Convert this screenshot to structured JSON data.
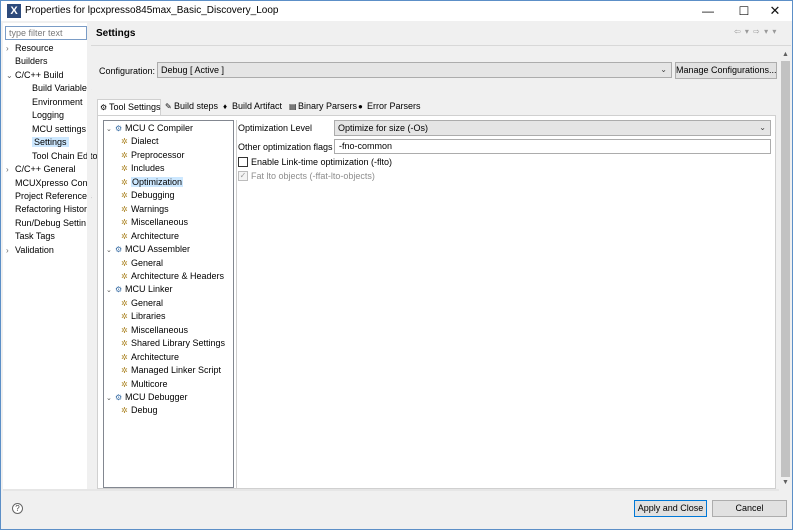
{
  "window": {
    "title": "Properties for lpcxpresso845max_Basic_Discovery_Loop",
    "app_icon": "X"
  },
  "filter": {
    "placeholder": "type filter text"
  },
  "nav": {
    "items": [
      {
        "label": "Resource",
        "toggle": "›"
      },
      {
        "label": "Builders",
        "toggle": ""
      },
      {
        "label": "C/C++ Build",
        "toggle": "⌄"
      },
      {
        "label": "Build Variables",
        "toggle": ""
      },
      {
        "label": "Environment",
        "toggle": ""
      },
      {
        "label": "Logging",
        "toggle": ""
      },
      {
        "label": "MCU settings",
        "toggle": ""
      },
      {
        "label": "Settings",
        "toggle": ""
      },
      {
        "label": "Tool Chain Edito",
        "toggle": ""
      },
      {
        "label": "C/C++ General",
        "toggle": "›"
      },
      {
        "label": "MCUXpresso Con",
        "toggle": ""
      },
      {
        "label": "Project References",
        "toggle": ""
      },
      {
        "label": "Refactoring Histor",
        "toggle": ""
      },
      {
        "label": "Run/Debug Settin",
        "toggle": ""
      },
      {
        "label": "Task Tags",
        "toggle": ""
      },
      {
        "label": "Validation",
        "toggle": "›"
      }
    ],
    "selected": "Settings"
  },
  "page": {
    "title": "Settings"
  },
  "configuration": {
    "label": "Configuration:",
    "value": "Debug  [ Active ]",
    "manage_button": "Manage Configurations..."
  },
  "tabs": [
    {
      "label": "Tool Settings",
      "icon": "⚙",
      "active": true
    },
    {
      "label": "Build steps",
      "icon": "✎",
      "active": false
    },
    {
      "label": "Build Artifact",
      "icon": "♦",
      "active": false
    },
    {
      "label": "Binary Parsers",
      "icon": "▤",
      "active": false
    },
    {
      "label": "Error Parsers",
      "icon": "●",
      "active": false
    }
  ],
  "tree": {
    "rows": [
      {
        "label": "MCU C Compiler",
        "level": 0,
        "toggle": "⌄",
        "icon": "tool"
      },
      {
        "label": "Dialect",
        "level": 1,
        "icon": "gear"
      },
      {
        "label": "Preprocessor",
        "level": 1,
        "icon": "gear"
      },
      {
        "label": "Includes",
        "level": 1,
        "icon": "gear"
      },
      {
        "label": "Optimization",
        "level": 1,
        "icon": "gear"
      },
      {
        "label": "Debugging",
        "level": 1,
        "icon": "gear"
      },
      {
        "label": "Warnings",
        "level": 1,
        "icon": "gear"
      },
      {
        "label": "Miscellaneous",
        "level": 1,
        "icon": "gear"
      },
      {
        "label": "Architecture",
        "level": 1,
        "icon": "gear"
      },
      {
        "label": "MCU Assembler",
        "level": 0,
        "toggle": "⌄",
        "icon": "tool"
      },
      {
        "label": "General",
        "level": 1,
        "icon": "gear"
      },
      {
        "label": "Architecture & Headers",
        "level": 1,
        "icon": "gear"
      },
      {
        "label": "MCU Linker",
        "level": 0,
        "toggle": "⌄",
        "icon": "tool"
      },
      {
        "label": "General",
        "level": 1,
        "icon": "gear"
      },
      {
        "label": "Libraries",
        "level": 1,
        "icon": "gear"
      },
      {
        "label": "Miscellaneous",
        "level": 1,
        "icon": "gear"
      },
      {
        "label": "Shared Library Settings",
        "level": 1,
        "icon": "gear"
      },
      {
        "label": "Architecture",
        "level": 1,
        "icon": "gear"
      },
      {
        "label": "Managed Linker Script",
        "level": 1,
        "icon": "gear"
      },
      {
        "label": "Multicore",
        "level": 1,
        "icon": "gear"
      },
      {
        "label": "MCU Debugger",
        "level": 0,
        "toggle": "⌄",
        "icon": "tool"
      },
      {
        "label": "Debug",
        "level": 1,
        "icon": "gear"
      }
    ],
    "selected_index": 4
  },
  "optimization": {
    "level_label": "Optimization Level",
    "level_value": "Optimize for size (-Os)",
    "flags_label": "Other optimization flags",
    "flags_value": "-fno-common",
    "lto_label": "Enable Link-time optimization (-flto)",
    "lto_checked": false,
    "fat_lto_label": "Fat lto objects (-ffat-lto-objects)",
    "fat_lto_checked": true,
    "fat_lto_enabled": false
  },
  "buttons": {
    "apply_close": "Apply and Close",
    "cancel": "Cancel"
  },
  "glyphs": {
    "minimize": "—",
    "maximize": "☐",
    "close": "✕",
    "history": "⇦ ▾ ⇨ ▾ ▾",
    "dropdown": "⌄",
    "scroll_up": "▲",
    "scroll_down": "▼",
    "help": "?",
    "check": "✓"
  }
}
